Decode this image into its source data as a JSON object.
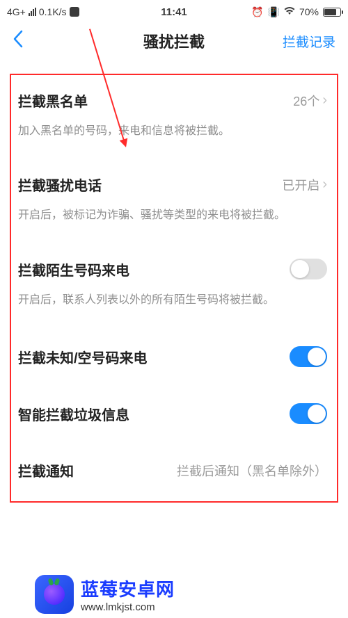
{
  "status_bar": {
    "network": "4G+",
    "speed": "0.1K/s",
    "time": "11:41",
    "battery_pct": "70%"
  },
  "header": {
    "title": "骚扰拦截",
    "right_action": "拦截记录"
  },
  "rows": {
    "blacklist": {
      "title": "拦截黑名单",
      "value": "26个",
      "desc": "加入黑名单的号码，来电和信息将被拦截。"
    },
    "spam_calls": {
      "title": "拦截骚扰电话",
      "value": "已开启",
      "desc": "开启后，被标记为诈骗、骚扰等类型的来电将被拦截。"
    },
    "unknown_caller": {
      "title": "拦截陌生号码来电",
      "on": false,
      "desc": "开启后，联系人列表以外的所有陌生号码将被拦截。"
    },
    "empty_number": {
      "title": "拦截未知/空号码来电",
      "on": true
    },
    "smart_sms": {
      "title": "智能拦截垃圾信息",
      "on": true
    },
    "notify": {
      "title": "拦截通知",
      "value": "拦截后通知（黑名单除外）"
    }
  },
  "watermark": {
    "name": "蓝莓安卓网",
    "url": "www.lmkjst.com"
  },
  "colors": {
    "accent": "#1a8cff",
    "annotation": "#ff2a2a"
  }
}
